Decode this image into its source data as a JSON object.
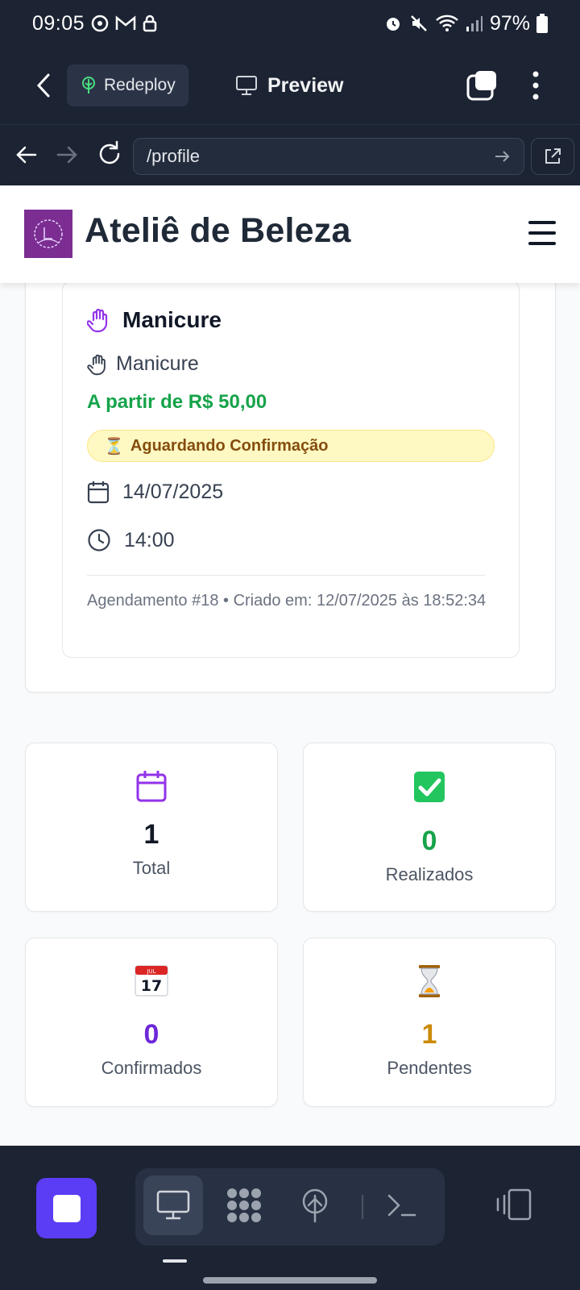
{
  "status_bar": {
    "time": "09:05",
    "battery": "97%"
  },
  "toolbar": {
    "redeploy_label": "Redeploy",
    "preview_label": "Preview"
  },
  "browser": {
    "url": "/profile"
  },
  "site": {
    "title": "Ateliê de Beleza"
  },
  "appointment": {
    "title": "Manicure",
    "service": "Manicure",
    "price": "A partir de R$ 50,00",
    "status": "Aguardando Confirmação",
    "status_emoji": "⏳",
    "date": "14/07/2025",
    "time": "14:00",
    "meta": "Agendamento #18 • Criado em: 12/07/2025 às 18:52:34"
  },
  "stats": [
    {
      "value": "1",
      "label": "Total",
      "icon": "calendar-icon",
      "color": "#111827"
    },
    {
      "value": "0",
      "label": "Realizados",
      "icon": "check-mark-icon",
      "color": "#16a34a"
    },
    {
      "value": "0",
      "label": "Confirmados",
      "icon": "calendar-17-icon",
      "color": "#6d28d9"
    },
    {
      "value": "1",
      "label": "Pendentes",
      "icon": "hourglass-icon",
      "color": "#ca8a04"
    }
  ],
  "colors": {
    "dark_chrome": "#1c2333",
    "accent_purple": "#7c3aed",
    "price_green": "#16a34a",
    "badge_yellow": "#fef9c3",
    "stop_button": "#5b3df5"
  }
}
